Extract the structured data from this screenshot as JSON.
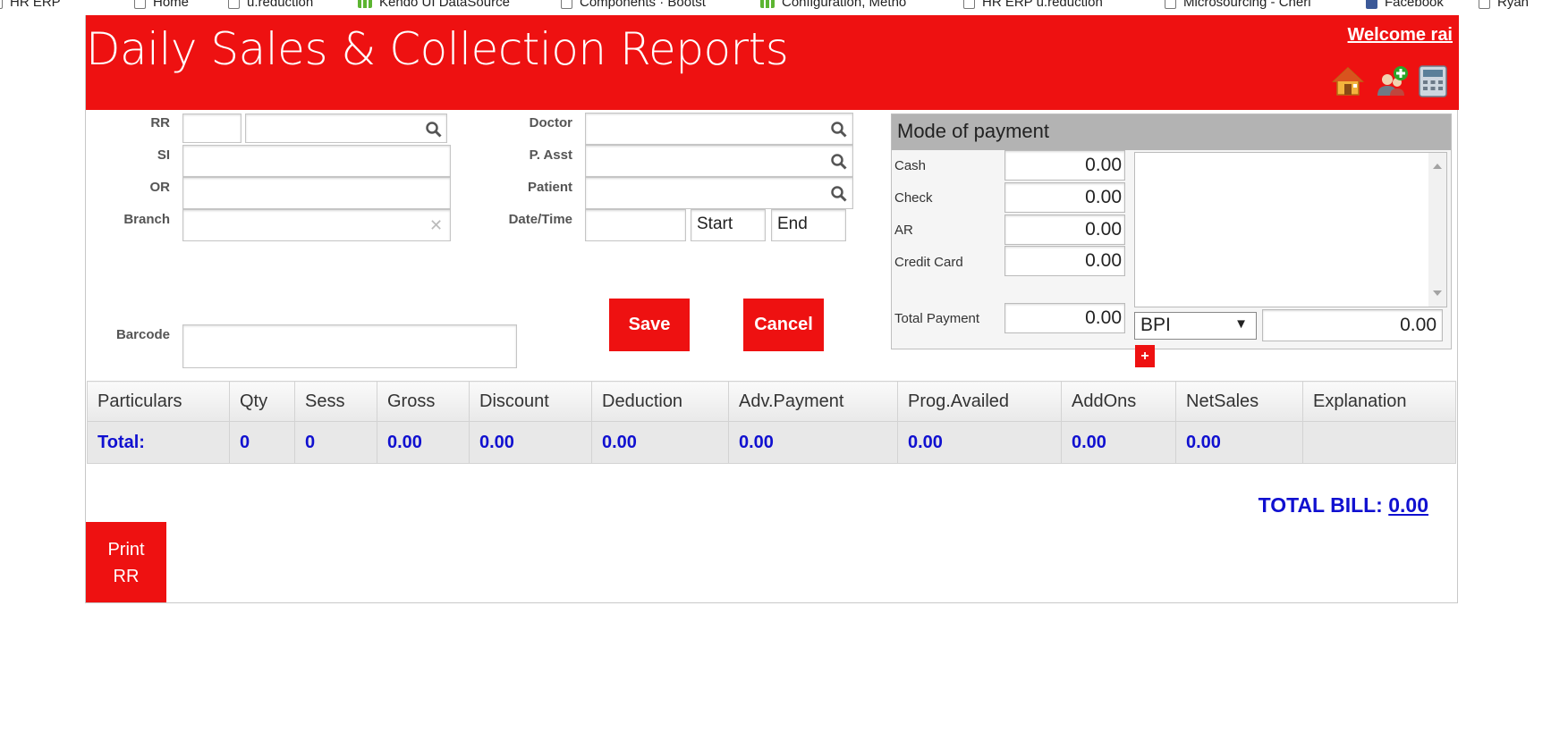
{
  "bookmarks": [
    {
      "label": "HR ERP",
      "icon": "page-icon"
    },
    {
      "label": "Home",
      "icon": "page-icon"
    },
    {
      "label": "u.reduction",
      "icon": "page-icon"
    },
    {
      "label": "Kendo UI DataSource",
      "icon": "kendo-icon"
    },
    {
      "label": "Components · Bootst",
      "icon": "page-icon"
    },
    {
      "label": "Configuration, Metho",
      "icon": "kendo-icon"
    },
    {
      "label": "HR ERP u.reduction",
      "icon": "page-icon"
    },
    {
      "label": "Microsourcing - Cheri",
      "icon": "page-icon"
    },
    {
      "label": "Facebook",
      "icon": "facebook-icon"
    },
    {
      "label": "Ryan",
      "icon": "page-icon"
    }
  ],
  "header": {
    "title": "Daily Sales & Collection Reports",
    "welcome": "Welcome rai",
    "icons": [
      "home-icon",
      "add-user-icon",
      "calculator-icon"
    ],
    "accent": "#ee1111"
  },
  "form": {
    "rr_label": "RR",
    "si_label": "SI",
    "or_label": "OR",
    "branch_label": "Branch",
    "barcode_label": "Barcode",
    "doctor_label": "Doctor",
    "passt_label": "P. Asst",
    "patient_label": "Patient",
    "datetime_label": "Date/Time",
    "start_value": "Start",
    "end_value": "End",
    "save_label": "Save",
    "cancel_label": "Cancel"
  },
  "payment": {
    "title": "Mode of payment",
    "rows": [
      {
        "label": "Cash",
        "value": "0.00"
      },
      {
        "label": "Check",
        "value": "0.00"
      },
      {
        "label": "AR",
        "value": "0.00"
      },
      {
        "label": "Credit Card",
        "value": "0.00"
      }
    ],
    "total_label": "Total Payment",
    "total_value": "0.00",
    "bank_selected": "BPI",
    "bank_amount": "0.00",
    "add_label": "+"
  },
  "table": {
    "columns": [
      "Particulars",
      "Qty",
      "Sess",
      "Gross",
      "Discount",
      "Deduction",
      "Adv.Payment",
      "Prog.Availed",
      "AddOns",
      "NetSales",
      "Explanation"
    ],
    "total_row": [
      "Total:",
      "0",
      "0",
      "0.00",
      "0.00",
      "0.00",
      "0.00",
      "0.00",
      "0.00",
      "0.00",
      ""
    ]
  },
  "total_bill": {
    "label": "TOTAL BILL:",
    "amount": "0.00"
  },
  "print_button": {
    "line1": "Print",
    "line2": "RR"
  }
}
